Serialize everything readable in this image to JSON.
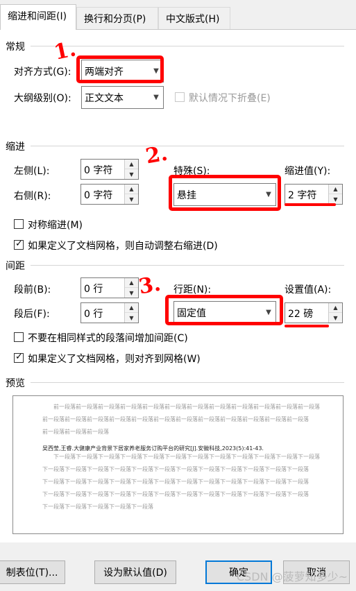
{
  "tabs": [
    {
      "label": "缩进和间距(I)"
    },
    {
      "label": "换行和分页(P)"
    },
    {
      "label": "中文版式(H)"
    }
  ],
  "general": {
    "title": "常规",
    "alignment_label": "对齐方式(G):",
    "alignment_value": "两端对齐",
    "outline_label": "大纲级别(O):",
    "outline_value": "正文文本",
    "collapse_label": "默认情况下折叠(E)"
  },
  "indent": {
    "title": "缩进",
    "left_label": "左侧(L):",
    "left_value": "0 字符",
    "right_label": "右侧(R):",
    "right_value": "0 字符",
    "special_label": "特殊(S):",
    "special_value": "悬挂",
    "by_label": "缩进值(Y):",
    "by_value": "2 字符",
    "mirror_label": "对称缩进(M)",
    "auto_adjust_label": "如果定义了文档网格，则自动调整右缩进(D)"
  },
  "spacing": {
    "title": "间距",
    "before_label": "段前(B):",
    "before_value": "0 行",
    "after_label": "段后(F):",
    "after_value": "0 行",
    "line_label": "行距(N):",
    "line_value": "固定值",
    "at_label": "设置值(A):",
    "at_value": "22 磅",
    "no_space_label": "不要在相同样式的段落间增加间距(C)",
    "snap_grid_label": "如果定义了文档网格，则对齐到网格(W)"
  },
  "preview": {
    "title": "预览",
    "prev_lines": [
      "前一段落前一段落前一段落前一段落前一段落前一段落前一段落前一段落前一段落前一段落前一段落前一段落",
      "前一段落前一段落前一段落前一段落前一段落前一段落前一段落前一段落前一段落前一段落前一段落前一段落",
      "前一段落前一段落前一段落"
    ],
    "main_line": "吴西莹,王睿.大健康产业背景下居家养老服务订购平台的研究[J].安徽科技,2023(5):41-43.",
    "next_lines": [
      "下一段落下一段落下一段落下一段落下一段落下一段落下一段落下一段落下一段落下一段落下一段落下一段落",
      "下一段落下一段落下一段落下一段落下一段落下一段落下一段落下一段落下一段落下一段落下一段落下一段落",
      "下一段落下一段落下一段落下一段落下一段落下一段落下一段落下一段落下一段落下一段落下一段落下一段落",
      "下一段落下一段落下一段落下一段落下一段落下一段落下一段落下一段落下一段落下一段落下一段落下一段落",
      "下一段落下一段落下一段落下一段落下一段落"
    ]
  },
  "buttons": {
    "tabs": "制表位(T)...",
    "set_default": "设为默认值(D)",
    "ok": "确定",
    "cancel": "取消"
  },
  "annotations": {
    "mark1": "1.",
    "mark2": "2.",
    "mark3": "3.",
    "color": "#ff0000"
  },
  "watermark": "CSDN @菠萝知多少~"
}
